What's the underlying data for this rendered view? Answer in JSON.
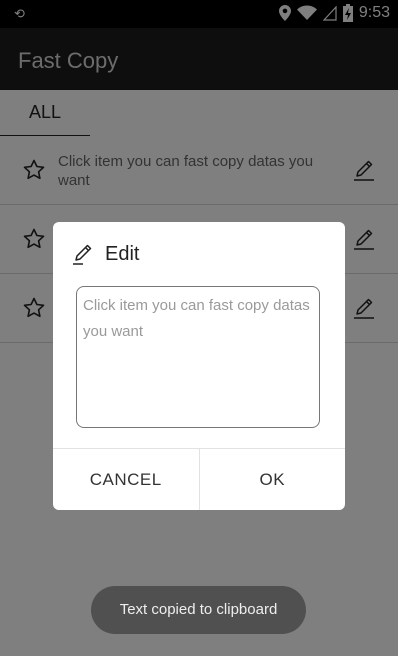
{
  "status_bar": {
    "notification_icon": "sync-icon",
    "time": "9:53"
  },
  "app": {
    "title": "Fast Copy"
  },
  "tabs": [
    {
      "label": "ALL",
      "selected": true
    }
  ],
  "list": {
    "items": [
      {
        "text": "Click item you can fast copy datas you want",
        "starred": false
      },
      {
        "text": "",
        "starred": false
      },
      {
        "text": "",
        "starred": false
      }
    ]
  },
  "dialog": {
    "title": "Edit",
    "field_placeholder": "Click item you can fast copy datas you want",
    "cancel_label": "CANCEL",
    "ok_label": "OK"
  },
  "toast": {
    "message": "Text copied to clipboard"
  },
  "colors": {
    "app_bar": "#1c1c1c",
    "status_bar": "#000000",
    "scrim": "rgba(0,0,0,0.5)",
    "toast": "#505050"
  }
}
